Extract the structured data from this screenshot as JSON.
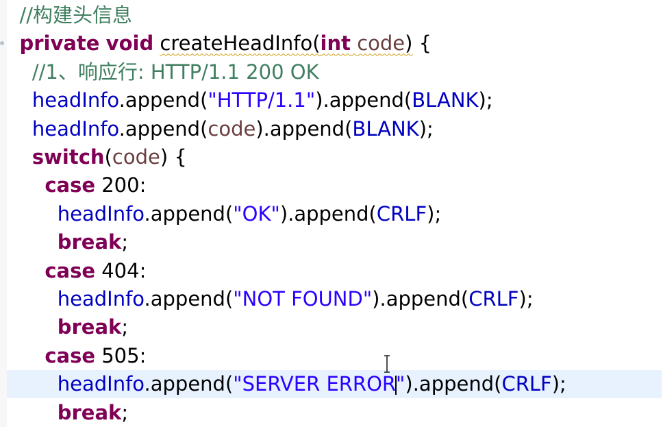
{
  "code_editor": {
    "lines": [
      {
        "indent": "  ",
        "tokens": [
          {
            "cls": "comment",
            "text": "//构建头信息"
          }
        ]
      },
      {
        "indent": "  ",
        "tokens": [
          {
            "cls": "keyword",
            "text": "private"
          },
          {
            "cls": "plain",
            "text": " "
          },
          {
            "cls": "keyword",
            "text": "void"
          },
          {
            "cls": "plain",
            "text": " "
          },
          {
            "cls": "plain squiggle",
            "text": "createHeadInfo("
          },
          {
            "cls": "keyword squiggle",
            "text": "int"
          },
          {
            "cls": "plain squiggle",
            "text": " "
          },
          {
            "cls": "param squiggle",
            "text": "code"
          },
          {
            "cls": "plain squiggle",
            "text": ")"
          },
          {
            "cls": "plain",
            "text": " {"
          }
        ]
      },
      {
        "indent": "    ",
        "tokens": [
          {
            "cls": "comment",
            "text": "//1、响应行: HTTP/1.1 200 OK"
          }
        ]
      },
      {
        "indent": "    ",
        "tokens": [
          {
            "cls": "field",
            "text": "headInfo"
          },
          {
            "cls": "plain",
            "text": ".append("
          },
          {
            "cls": "str",
            "text": "\"HTTP/1.1\""
          },
          {
            "cls": "plain",
            "text": ").append("
          },
          {
            "cls": "field",
            "text": "BLANK"
          },
          {
            "cls": "plain",
            "text": ");"
          }
        ]
      },
      {
        "indent": "    ",
        "tokens": [
          {
            "cls": "field",
            "text": "headInfo"
          },
          {
            "cls": "plain",
            "text": ".append("
          },
          {
            "cls": "param",
            "text": "code"
          },
          {
            "cls": "plain",
            "text": ").append("
          },
          {
            "cls": "field",
            "text": "BLANK"
          },
          {
            "cls": "plain",
            "text": ");"
          }
        ]
      },
      {
        "indent": "    ",
        "tokens": [
          {
            "cls": "keyword",
            "text": "switch"
          },
          {
            "cls": "plain",
            "text": "("
          },
          {
            "cls": "param",
            "text": "code"
          },
          {
            "cls": "plain",
            "text": ") {"
          }
        ]
      },
      {
        "indent": "      ",
        "tokens": [
          {
            "cls": "keyword",
            "text": "case"
          },
          {
            "cls": "plain",
            "text": " 200:"
          }
        ]
      },
      {
        "indent": "        ",
        "tokens": [
          {
            "cls": "field",
            "text": "headInfo"
          },
          {
            "cls": "plain",
            "text": ".append("
          },
          {
            "cls": "str",
            "text": "\"OK\""
          },
          {
            "cls": "plain",
            "text": ").append("
          },
          {
            "cls": "field",
            "text": "CRLF"
          },
          {
            "cls": "plain",
            "text": ");"
          }
        ]
      },
      {
        "indent": "        ",
        "tokens": [
          {
            "cls": "keyword",
            "text": "break"
          },
          {
            "cls": "plain",
            "text": ";"
          }
        ]
      },
      {
        "indent": "      ",
        "tokens": [
          {
            "cls": "keyword",
            "text": "case"
          },
          {
            "cls": "plain",
            "text": " 404:"
          }
        ]
      },
      {
        "indent": "        ",
        "tokens": [
          {
            "cls": "field",
            "text": "headInfo"
          },
          {
            "cls": "plain",
            "text": ".append("
          },
          {
            "cls": "str",
            "text": "\"NOT FOUND\""
          },
          {
            "cls": "plain",
            "text": ").append("
          },
          {
            "cls": "field",
            "text": "CRLF"
          },
          {
            "cls": "plain",
            "text": ");"
          }
        ]
      },
      {
        "indent": "        ",
        "tokens": [
          {
            "cls": "keyword",
            "text": "break"
          },
          {
            "cls": "plain",
            "text": ";"
          }
        ]
      },
      {
        "indent": "      ",
        "tokens": [
          {
            "cls": "keyword",
            "text": "case"
          },
          {
            "cls": "plain",
            "text": " 505:"
          }
        ]
      },
      {
        "indent": "        ",
        "current": true,
        "tokens": [
          {
            "cls": "field",
            "text": "headInfo"
          },
          {
            "cls": "plain",
            "text": ".append("
          },
          {
            "cls": "str",
            "text": "\"SERVER ERROR"
          },
          {
            "cls": "caret",
            "text": ""
          },
          {
            "cls": "str",
            "text": "\""
          },
          {
            "cls": "plain",
            "text": ").append("
          },
          {
            "cls": "field",
            "text": "CRLF"
          },
          {
            "cls": "plain",
            "text": ");"
          }
        ]
      },
      {
        "indent": "        ",
        "tokens": [
          {
            "cls": "keyword",
            "text": "break"
          },
          {
            "cls": "plain",
            "text": ";"
          }
        ]
      }
    ]
  },
  "pointer": {
    "icon": "text-ibeam-cursor-icon"
  }
}
